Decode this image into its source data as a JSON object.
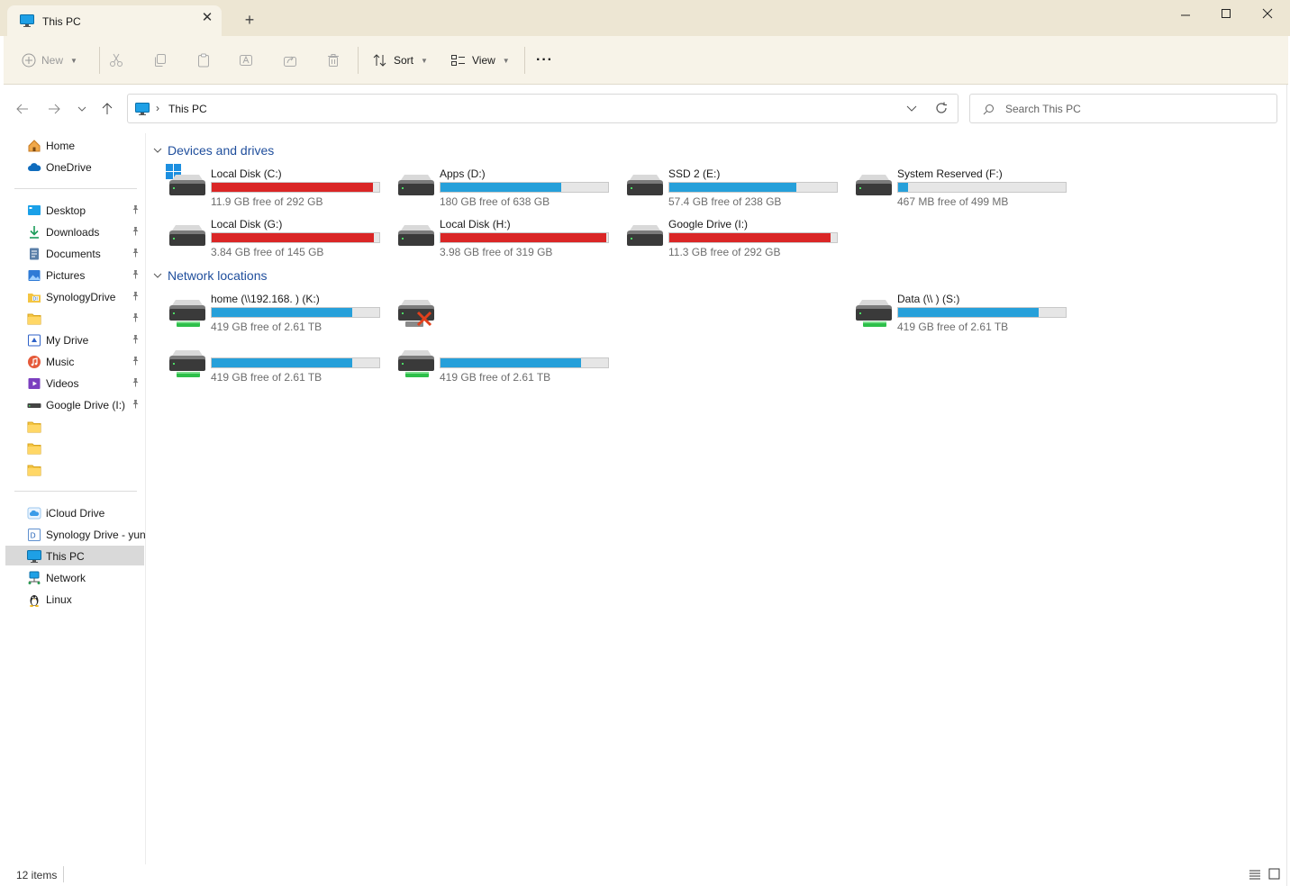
{
  "window": {
    "tab_title": "This PC",
    "new_tab": "+"
  },
  "toolbar": {
    "new_label": "New",
    "sort_label": "Sort",
    "view_label": "View",
    "more_label": "···"
  },
  "address": {
    "path": "This PC",
    "separator": "›",
    "search_placeholder": "Search This PC"
  },
  "sidebar": {
    "top": [
      {
        "label": "Home",
        "icon": "home-icon"
      },
      {
        "label": "OneDrive",
        "icon": "cloud-icon"
      }
    ],
    "quick": [
      {
        "label": "Desktop",
        "icon": "desktop-icon",
        "pinned": true
      },
      {
        "label": "Downloads",
        "icon": "download-icon",
        "pinned": true
      },
      {
        "label": "Documents",
        "icon": "document-icon",
        "pinned": true
      },
      {
        "label": "Pictures",
        "icon": "picture-icon",
        "pinned": true
      },
      {
        "label": "SynologyDrive",
        "icon": "synology-folder-icon",
        "pinned": true
      },
      {
        "label": "",
        "icon": "folder-icon",
        "pinned": true
      },
      {
        "label": "My Drive",
        "icon": "my-drive-icon",
        "pinned": true
      },
      {
        "label": "Music",
        "icon": "music-icon",
        "pinned": true
      },
      {
        "label": "Videos",
        "icon": "video-icon",
        "pinned": true
      },
      {
        "label": "Google Drive (I:)",
        "icon": "drive-icon",
        "pinned": true
      },
      {
        "label": "",
        "icon": "folder-icon",
        "pinned": false
      },
      {
        "label": "",
        "icon": "folder-icon",
        "pinned": false
      },
      {
        "label": "",
        "icon": "folder-icon",
        "pinned": false
      }
    ],
    "bottom": [
      {
        "label": "iCloud Drive",
        "icon": "icloud-icon"
      },
      {
        "label": "Synology Drive - yun",
        "icon": "synology-drive-icon"
      },
      {
        "label": "This PC",
        "icon": "pc-icon",
        "selected": true
      },
      {
        "label": "Network",
        "icon": "network-icon"
      },
      {
        "label": "Linux",
        "icon": "linux-icon"
      }
    ]
  },
  "sections": {
    "devices": "Devices and drives",
    "network": "Network locations"
  },
  "drives": [
    {
      "name": "Local Disk (C:)",
      "free": "11.9 GB free of 292 GB",
      "used": 0.96,
      "type": "windows"
    },
    {
      "name": "Apps (D:)",
      "free": "180 GB free of 638 GB",
      "used": 0.72,
      "type": "disk"
    },
    {
      "name": "SSD 2 (E:)",
      "free": "57.4 GB free of 238 GB",
      "used": 0.76,
      "type": "disk"
    },
    {
      "name": "System Reserved (F:)",
      "free": "467 MB free of 499 MB",
      "used": 0.06,
      "type": "disk"
    },
    {
      "name": "Local Disk (G:)",
      "free": "3.84 GB free of 145 GB",
      "used": 0.97,
      "type": "disk"
    },
    {
      "name": "Local Disk (H:)",
      "free": "3.98 GB free of 319 GB",
      "used": 0.99,
      "type": "disk"
    },
    {
      "name": "Google Drive (I:)",
      "free": "11.3 GB free of 292 GB",
      "used": 0.96,
      "type": "disk"
    }
  ],
  "network_drives": [
    {
      "name": "home (\\\\192.168.        ) (K:)",
      "free": "419 GB free of 2.61 TB",
      "used": 0.84,
      "type": "net"
    },
    {
      "name": "",
      "free": "",
      "used": null,
      "type": "disconnected"
    },
    {
      "name": "",
      "free": "",
      "used": null,
      "type": "empty"
    },
    {
      "name": "Data (\\\\                    ) (S:)",
      "free": "419 GB free of 2.61 TB",
      "used": 0.84,
      "type": "net"
    },
    {
      "name": "",
      "free": "419 GB free of 2.61 TB",
      "used": 0.84,
      "type": "net"
    },
    {
      "name": "",
      "free": "419 GB free of 2.61 TB",
      "used": 0.84,
      "type": "net"
    }
  ],
  "status": {
    "items": "12 items"
  },
  "colors": {
    "bar_normal": "#26a0da",
    "bar_full": "#da2626",
    "section_header": "#1f4e9c",
    "title_bg": "#ede6d3"
  }
}
